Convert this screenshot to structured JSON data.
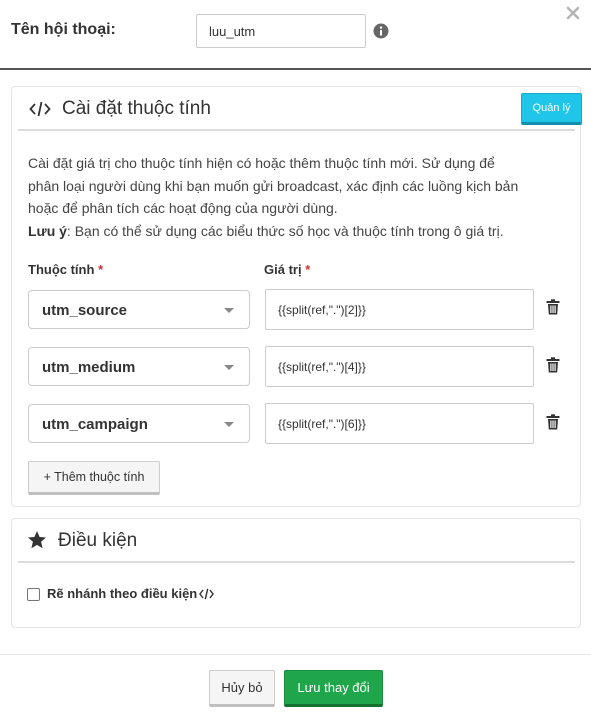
{
  "header": {
    "conversation_label": "Tên hội thoại:",
    "conversation_name_value": "luu_utm",
    "info_icon": "info-circle-icon",
    "close_icon": "close-icon"
  },
  "attributes_section": {
    "icon": "code-icon",
    "title": "Cài đặt thuộc tính",
    "manage_label": "Quản lý",
    "description_lines": [
      "Cài đặt giá trị cho thuộc tính hiện có hoặc thêm thuộc tính mới. Sử dụng để",
      "phân loại người dùng khi bạn muốn gửi broadcast, xác định các luồng kịch bản",
      "hoặc để phân tích các hoạt động của người dùng."
    ],
    "note_label": "Lưu ý",
    "note_text": ": Bạn có thể sử dụng các biểu thức số học và thuộc tính trong ô giá trị.",
    "attribute_header": "Thuộc tính",
    "value_header": "Giá trị",
    "required_marker": "*",
    "rows": [
      {
        "attribute": "utm_source",
        "value": "{{split(ref,\".\")[2]}}"
      },
      {
        "attribute": "utm_medium",
        "value": "{{split(ref,\".\")[4]}}"
      },
      {
        "attribute": "utm_campaign",
        "value": "{{split(ref,\".\")[6]}}"
      }
    ],
    "add_label": "+ Thêm thuộc tính",
    "delete_icon": "trash-icon"
  },
  "conditions_section": {
    "icon": "star-icon",
    "title": "Điều kiện",
    "branch_label": "Rẽ nhánh theo điều kiện",
    "branch_checked": false
  },
  "footer": {
    "cancel_label": "Hủy bỏ",
    "save_label": "Lưu thay đổi"
  },
  "colors": {
    "manage_button": "#20c5ea",
    "save_button": "#1fa64a",
    "required": "#cc3333"
  }
}
